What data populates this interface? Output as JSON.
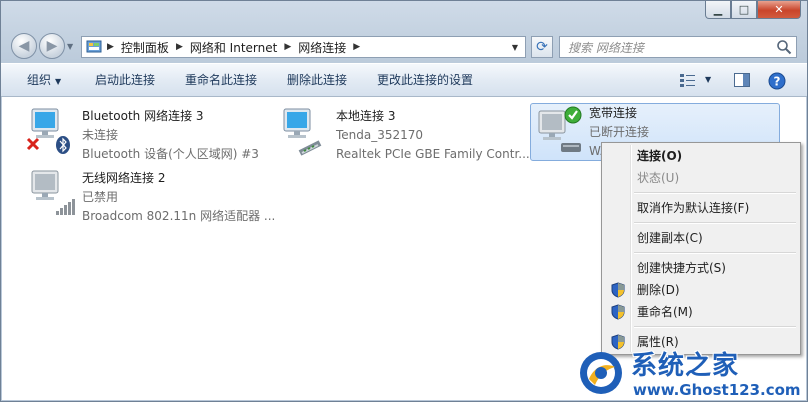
{
  "window": {
    "minimize_glyph": "▁",
    "maximize_glyph": "□",
    "close_glyph": "✕"
  },
  "navigation": {
    "back_glyph": "◀",
    "forward_glyph": "▶",
    "breadcrumbs": [
      "控制面板",
      "网络和 Internet",
      "网络连接"
    ],
    "search_placeholder": "搜索 网络连接"
  },
  "toolbar": {
    "organize": "组织",
    "enable": "启动此连接",
    "rename": "重命名此连接",
    "delete": "删除此连接",
    "change_settings": "更改此连接的设置"
  },
  "connections": [
    {
      "name": "Bluetooth 网络连接 3",
      "status": "未连接",
      "device": "Bluetooth 设备(个人区域网) #3"
    },
    {
      "name": "本地连接 3",
      "status": "Tenda_352170",
      "device": "Realtek PCIe GBE Family Contr..."
    },
    {
      "name": "宽带连接",
      "status": "已断开连接",
      "device": "WA"
    },
    {
      "name": "无线网络连接 2",
      "status": "已禁用",
      "device": "Broadcom 802.11n 网络适配器 ..."
    }
  ],
  "context_menu": {
    "items": [
      {
        "label": "连接(O)"
      },
      {
        "label": "状态(U)"
      },
      {
        "label": "取消作为默认连接(F)"
      },
      {
        "label": "创建副本(C)"
      },
      {
        "label": "创建快捷方式(S)"
      },
      {
        "label": "删除(D)"
      },
      {
        "label": "重命名(M)"
      },
      {
        "label": "属性(R)"
      }
    ]
  },
  "watermark": {
    "title": "系统之家",
    "url": "www.Ghost123.com"
  },
  "colors": {
    "accent": "#1f5fb8",
    "selection": "#cfe3fa",
    "menu_bg": "#f0f0f0"
  }
}
